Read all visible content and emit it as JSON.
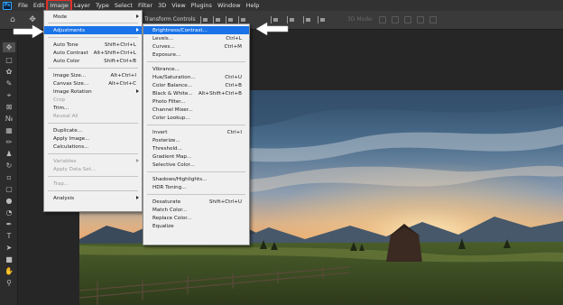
{
  "app": {
    "logo": "Ps"
  },
  "menubar": [
    "File",
    "Edit",
    "Image",
    "Layer",
    "Type",
    "Select",
    "Filter",
    "3D",
    "View",
    "Plugins",
    "Window",
    "Help"
  ],
  "options": {
    "transform_label": "Transform Controls",
    "mode_3d": "3D Mode:"
  },
  "image_menu": {
    "items": [
      {
        "label": "Mode",
        "shortcut": "",
        "arrow": true
      },
      {
        "label": "Adjustments",
        "shortcut": "",
        "arrow": true,
        "highlight": true
      },
      {
        "label": "Auto Tone",
        "shortcut": "Shift+Ctrl+L"
      },
      {
        "label": "Auto Contrast",
        "shortcut": "Alt+Shift+Ctrl+L"
      },
      {
        "label": "Auto Color",
        "shortcut": "Shift+Ctrl+B"
      },
      {
        "label": "Image Size...",
        "shortcut": "Alt+Ctrl+I"
      },
      {
        "label": "Canvas Size...",
        "shortcut": "Alt+Ctrl+C"
      },
      {
        "label": "Image Rotation",
        "shortcut": "",
        "arrow": true
      },
      {
        "label": "Crop",
        "shortcut": "",
        "disabled": true
      },
      {
        "label": "Trim...",
        "shortcut": ""
      },
      {
        "label": "Reveal All",
        "shortcut": "",
        "disabled": true
      },
      {
        "label": "Duplicate...",
        "shortcut": ""
      },
      {
        "label": "Apply Image...",
        "shortcut": ""
      },
      {
        "label": "Calculations...",
        "shortcut": ""
      },
      {
        "label": "Variables",
        "shortcut": "",
        "arrow": true,
        "disabled": true
      },
      {
        "label": "Apply Data Set...",
        "shortcut": "",
        "disabled": true
      },
      {
        "label": "Trap...",
        "shortcut": "",
        "disabled": true
      },
      {
        "label": "Analysis",
        "shortcut": "",
        "arrow": true
      }
    ]
  },
  "adjustments_menu": {
    "items": [
      {
        "label": "Brightness/Contrast...",
        "shortcut": "",
        "highlight": true
      },
      {
        "label": "Levels...",
        "shortcut": "Ctrl+L"
      },
      {
        "label": "Curves...",
        "shortcut": "Ctrl+M"
      },
      {
        "label": "Exposure...",
        "shortcut": ""
      },
      {
        "label": "Vibrance...",
        "shortcut": ""
      },
      {
        "label": "Hue/Saturation...",
        "shortcut": "Ctrl+U"
      },
      {
        "label": "Color Balance...",
        "shortcut": "Ctrl+B"
      },
      {
        "label": "Black & White...",
        "shortcut": "Alt+Shift+Ctrl+B"
      },
      {
        "label": "Photo Filter...",
        "shortcut": ""
      },
      {
        "label": "Channel Mixer...",
        "shortcut": ""
      },
      {
        "label": "Color Lookup...",
        "shortcut": ""
      },
      {
        "label": "Invert",
        "shortcut": "Ctrl+I"
      },
      {
        "label": "Posterize...",
        "shortcut": ""
      },
      {
        "label": "Threshold...",
        "shortcut": ""
      },
      {
        "label": "Gradient Map...",
        "shortcut": ""
      },
      {
        "label": "Selective Color...",
        "shortcut": ""
      },
      {
        "label": "Shadows/Highlights...",
        "shortcut": ""
      },
      {
        "label": "HDR Toning...",
        "shortcut": ""
      },
      {
        "label": "Desaturate",
        "shortcut": "Shift+Ctrl+U"
      },
      {
        "label": "Match Color...",
        "shortcut": ""
      },
      {
        "label": "Replace Color...",
        "shortcut": ""
      },
      {
        "label": "Equalize",
        "shortcut": ""
      }
    ]
  },
  "colors": {
    "highlight": "#1a73e8",
    "annotation": "#e0302a",
    "menu_bg": "#f0f0f0"
  }
}
